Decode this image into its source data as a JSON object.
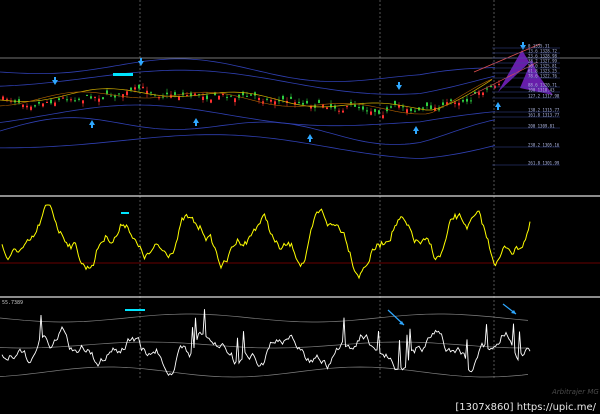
{
  "chart_data": [
    {
      "type": "candlestick",
      "panel": "price",
      "fib_levels": [
        {
          "label": "0 1335.31"
        },
        {
          "label": "13.6 1328.72"
        },
        {
          "label": "23.6 1328.98"
        },
        {
          "label": "38.2 1327.99"
        },
        {
          "label": "50.0 1325.81"
        },
        {
          "label": "61.8 1323.25"
        },
        {
          "label": "78.6 1322.76"
        },
        {
          "label": "88.6 1320.71"
        },
        {
          "label": "100 1318.43"
        },
        {
          "label": "127.2 1317.98"
        },
        {
          "label": "138.2 1315.77"
        },
        {
          "label": "161.8 1313.77"
        },
        {
          "label": "200 1309.81"
        },
        {
          "label": "238.2 1305.16"
        },
        {
          "label": "261.8 1301.99"
        }
      ],
      "signal_up_arrows": 5,
      "signal_down_arrows": 4,
      "colors": {
        "up": "#2ecc40",
        "down": "#ff3030",
        "bands": "#2f3fb0",
        "pattern": "#7a22c8",
        "arrows": "#2fa8ff"
      }
    },
    {
      "type": "line",
      "panel": "oscillator-1",
      "colors": {
        "line": "#ffff00",
        "baseline": "#8b0000"
      }
    },
    {
      "type": "line",
      "panel": "oscillator-2",
      "level_label": "55.7389",
      "colors": {
        "line": "#ffffff",
        "bands": "#808080",
        "arrows": "#2fa8ff"
      }
    }
  ],
  "watermark": "Arbitrajer MG",
  "footer": "[1307x860] https://upic.me/"
}
